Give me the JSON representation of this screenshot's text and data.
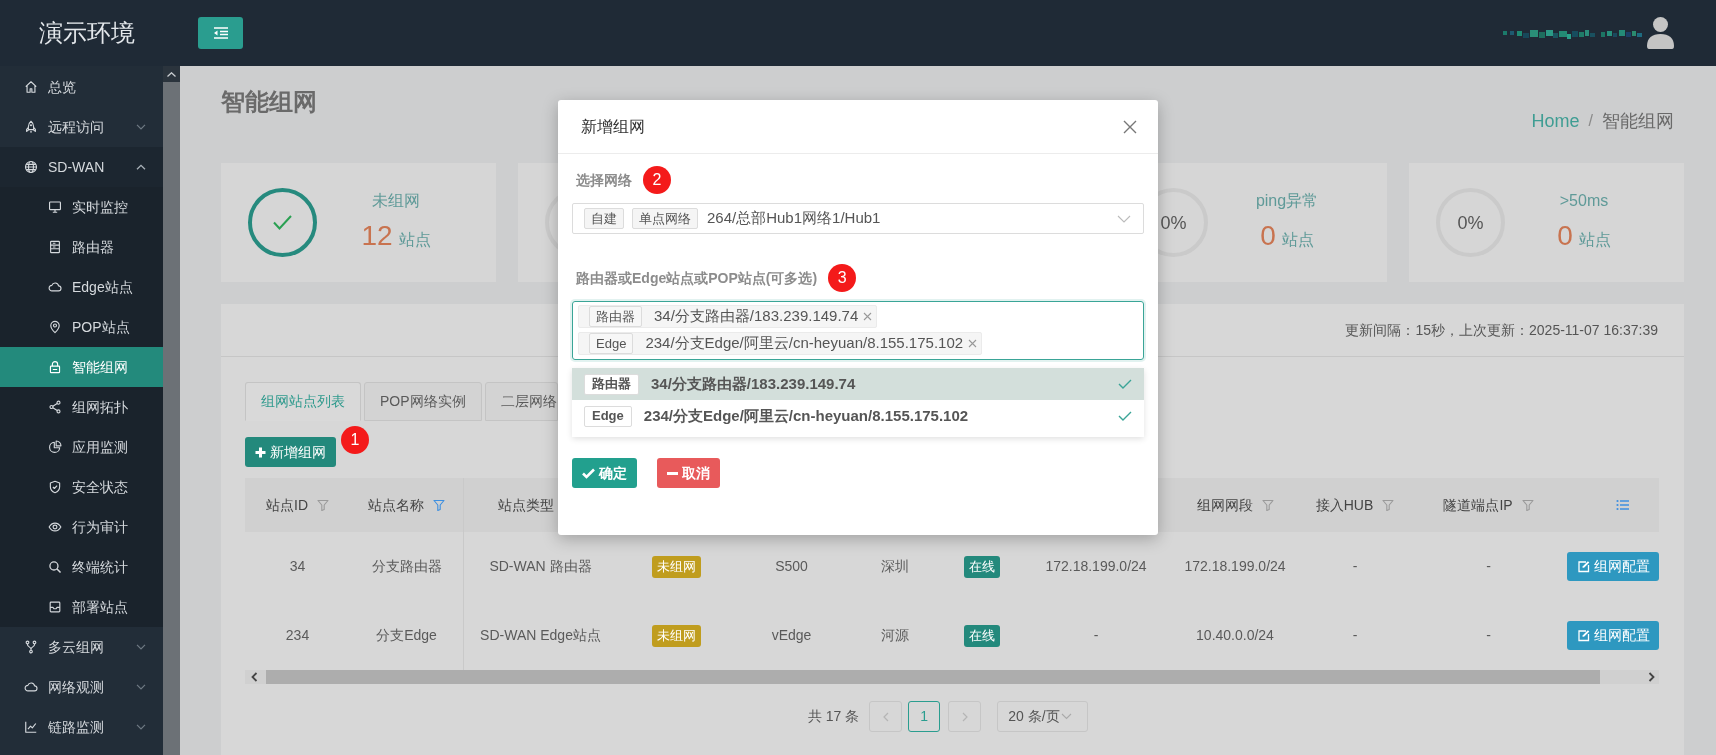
{
  "header": {
    "title": "演示环境"
  },
  "sidebar": {
    "items": [
      {
        "label": "总览",
        "kind": "link",
        "selected": false
      },
      {
        "label": "远程访问",
        "kind": "group",
        "expanded": false,
        "selected": false
      },
      {
        "label": "SD-WAN",
        "kind": "group",
        "expanded": true,
        "selected": false,
        "children": [
          {
            "label": "实时监控",
            "selected": false
          },
          {
            "label": "路由器",
            "selected": false
          },
          {
            "label": "Edge站点",
            "selected": false
          },
          {
            "label": "POP站点",
            "selected": false
          },
          {
            "label": "智能组网",
            "selected": true
          },
          {
            "label": "组网拓扑",
            "selected": false
          },
          {
            "label": "应用监测",
            "selected": false
          },
          {
            "label": "安全状态",
            "selected": false
          },
          {
            "label": "行为审计",
            "selected": false
          },
          {
            "label": "终端统计",
            "selected": false
          },
          {
            "label": "部署站点",
            "selected": false
          }
        ]
      },
      {
        "label": "多云组网",
        "kind": "group",
        "expanded": false,
        "selected": false
      },
      {
        "label": "网络观测",
        "kind": "group",
        "expanded": false,
        "selected": false
      },
      {
        "label": "链路监测",
        "kind": "group",
        "expanded": false,
        "selected": false
      }
    ]
  },
  "page": {
    "title": "智能组网",
    "breadcrumb": {
      "items": [
        {
          "label": "Home",
          "kind": "link"
        },
        {
          "label": "智能组网",
          "kind": "current"
        }
      ],
      "separator": "/"
    }
  },
  "stat_cards": [
    {
      "kind": "check",
      "label": "未组网",
      "value": "12",
      "unit": "站点"
    },
    {
      "kind": "ring"
    },
    {
      "kind": "percent",
      "percent": "0%",
      "label": "ping异常",
      "value": "0",
      "unit": "站点"
    },
    {
      "kind": "percent",
      "percent": "0%",
      "label": ">50ms",
      "value": "0",
      "unit": "站点"
    }
  ],
  "panel": {
    "update_info": "更新间隔：15秒，上次更新：2025-11-07 16:37:39",
    "tabs": [
      {
        "label": "组网站点列表",
        "selected": true
      },
      {
        "label": "POP网络实例",
        "selected": false
      },
      {
        "label": "二层网络",
        "selected": false
      }
    ],
    "add_button": {
      "label": "新增组网",
      "step": "1"
    },
    "table": {
      "columns": [
        {
          "label": "站点ID",
          "kind": "filter",
          "filtered": false
        },
        {
          "label": "站点名称",
          "kind": "filter",
          "filtered": true
        },
        {
          "label": "站点类型",
          "kind": "plain"
        },
        null,
        null,
        null,
        null,
        null,
        {
          "label": "组网网段",
          "kind": "filter",
          "filtered": false
        },
        {
          "label": "接入HUB",
          "kind": "filter",
          "filtered": false
        },
        {
          "label": "隧道端点IP",
          "kind": "filter",
          "filtered": false
        },
        {
          "kind": "settings"
        }
      ],
      "rows": [
        {
          "cells": [
            {
              "kind": "text",
              "text": "34"
            },
            {
              "kind": "text",
              "text": "分支路由器"
            },
            {
              "kind": "text",
              "text": "SD-WAN 路由器"
            },
            {
              "kind": "tag",
              "text": "未组网",
              "color": "#c09d1e"
            },
            {
              "kind": "text",
              "text": "S500"
            },
            {
              "kind": "text",
              "text": "深圳"
            },
            {
              "kind": "tag",
              "text": "在线",
              "color": "#23897c"
            },
            {
              "kind": "text",
              "text": "172.18.199.0/24"
            },
            {
              "kind": "text",
              "text": "172.18.199.0/24"
            },
            {
              "kind": "text",
              "text": "-"
            },
            {
              "kind": "text",
              "text": "-"
            },
            {
              "kind": "button",
              "text": "组网配置"
            }
          ]
        },
        {
          "cells": [
            {
              "kind": "text",
              "text": "234"
            },
            {
              "kind": "text",
              "text": "分支Edge"
            },
            {
              "kind": "text",
              "text": "SD-WAN Edge站点"
            },
            {
              "kind": "tag",
              "text": "未组网",
              "color": "#c09d1e"
            },
            {
              "kind": "text",
              "text": "vEdge"
            },
            {
              "kind": "text",
              "text": "河源"
            },
            {
              "kind": "tag",
              "text": "在线",
              "color": "#23897c"
            },
            {
              "kind": "text",
              "text": "-"
            },
            {
              "kind": "text",
              "text": "10.40.0.0/24"
            },
            {
              "kind": "text",
              "text": "-"
            },
            {
              "kind": "text",
              "text": "-"
            },
            {
              "kind": "button",
              "text": "组网配置"
            }
          ]
        }
      ]
    },
    "pagination": {
      "total": "共 17 条",
      "pages": [
        {
          "label": "1",
          "selected": true
        }
      ],
      "page_size": "20 条/页"
    }
  },
  "modal": {
    "title": "新增组网",
    "network_field": {
      "label": "选择网络",
      "step": "2",
      "tags": [
        "自建",
        "单点网络"
      ],
      "value": "264/总部Hub1网络1/Hub1"
    },
    "devices_field": {
      "label": "路由器或Edge站点或POP站点(可多选)",
      "step": "3",
      "chips": [
        {
          "tag": "路由器",
          "text": "34/分支路由器/183.239.149.74"
        },
        {
          "tag": "Edge",
          "text": "234/分支Edge/阿里云/cn-heyuan/8.155.175.102"
        }
      ],
      "options": [
        {
          "tag": "路由器",
          "text": "34/分支路由器/183.239.149.74",
          "selected": true,
          "highlighted": true
        },
        {
          "tag": "Edge",
          "text": "234/分支Edge/阿里云/cn-heyuan/8.155.175.102",
          "selected": true,
          "highlighted": false
        }
      ]
    },
    "buttons": [
      {
        "label": "确定",
        "kind": "confirm"
      },
      {
        "label": "取消",
        "kind": "cancel"
      }
    ]
  }
}
